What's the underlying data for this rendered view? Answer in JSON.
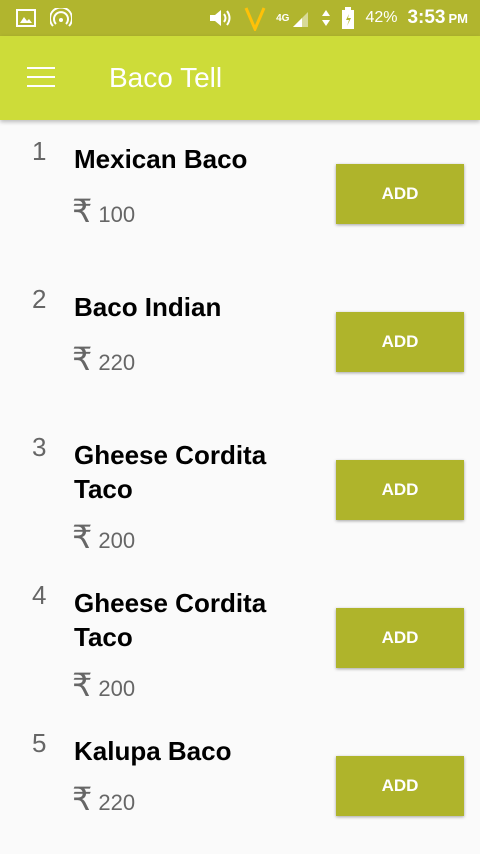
{
  "status_bar": {
    "battery": "42%",
    "time": "3:53",
    "ampm": "PM",
    "network": "4G",
    "icons": [
      "image-icon",
      "hotspot-icon",
      "volume-icon",
      "vodafone-icon",
      "signal-icon",
      "battery-icon"
    ]
  },
  "toolbar": {
    "title": "Baco Tell",
    "menu_icon": "hamburger-menu-icon"
  },
  "items": [
    {
      "num": "1",
      "name": "Mexican Baco",
      "currency": "₹",
      "price": "100",
      "button": "ADD"
    },
    {
      "num": "2",
      "name": "Baco Indian",
      "currency": "₹",
      "price": "220",
      "button": "ADD"
    },
    {
      "num": "3",
      "name": "Gheese Cordita Taco",
      "currency": "₹",
      "price": "200",
      "button": "ADD"
    },
    {
      "num": "4",
      "name": "Gheese Cordita Taco",
      "currency": "₹",
      "price": "200",
      "button": "ADD"
    },
    {
      "num": "5",
      "name": "Kalupa Baco",
      "currency": "₹",
      "price": "220",
      "button": "ADD"
    }
  ],
  "colors": {
    "status_bar": "#b1b52e",
    "toolbar": "#cddc39",
    "button": "#afb42b",
    "background": "#fafafa"
  }
}
